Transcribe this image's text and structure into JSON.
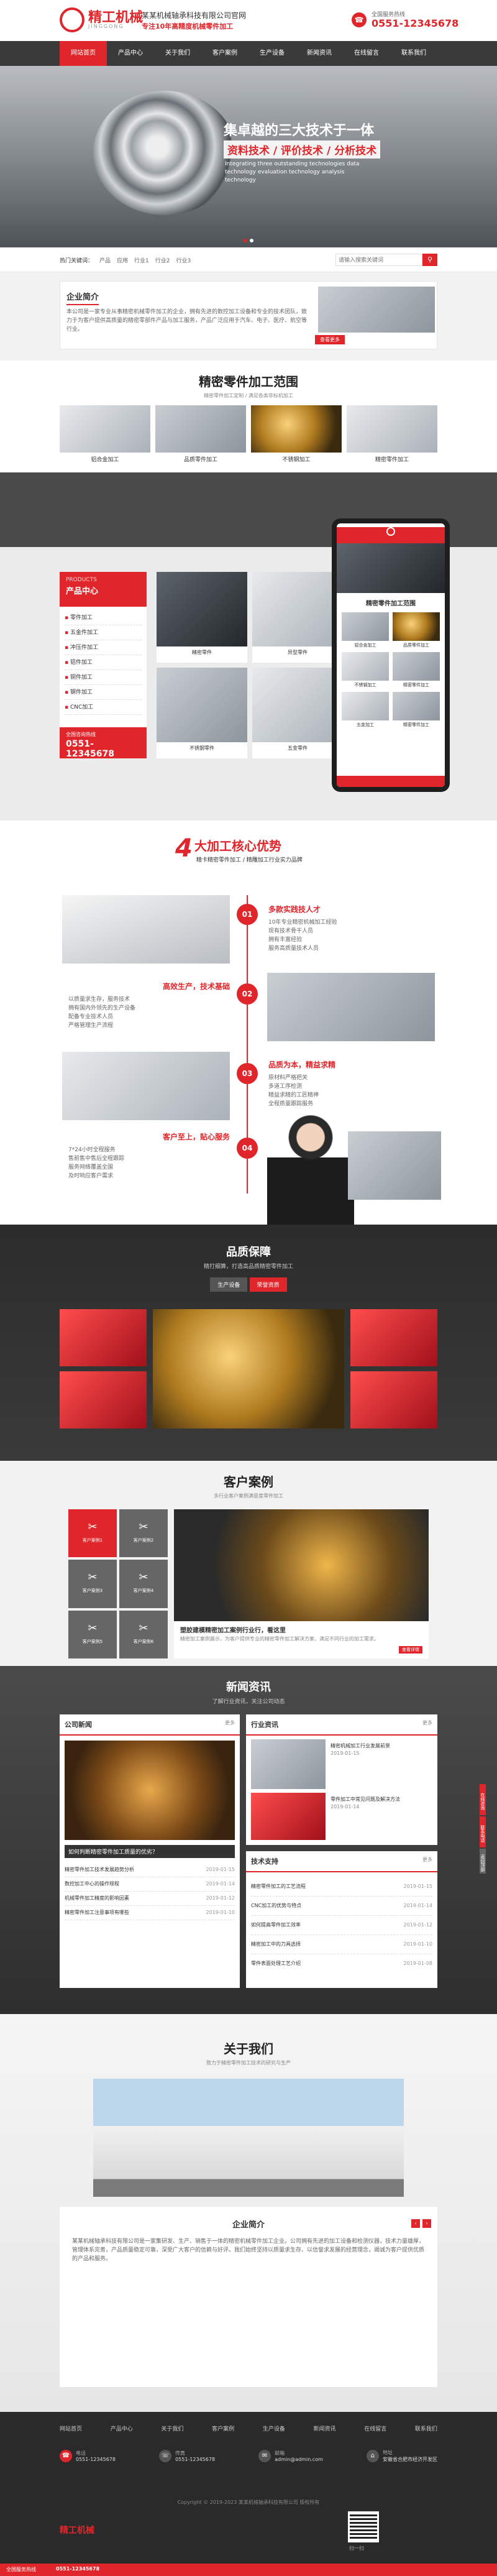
{
  "header": {
    "logo_text": "精工机械",
    "logo_sub": "JINGGONG",
    "company": "某某机械轴承科技有限公司官网",
    "slogan": "专注10年高精度机械零件加工",
    "hotline_label": "全国服务热线",
    "hotline": "0551-12345678"
  },
  "nav": {
    "items": [
      "网站首页",
      "产品中心",
      "关于我们",
      "客户案例",
      "生产设备",
      "新闻资讯",
      "在线留言",
      "联系我们"
    ]
  },
  "banner": {
    "title": "集卓越的三大技术于一体",
    "subtitle": "资料技术 / 评价技术 / 分析技术",
    "en": "Integrating three outstanding technologies data technology evaluation technology analysis technology"
  },
  "search": {
    "hot_label": "热门关键词：",
    "keywords": [
      "产品",
      "应用",
      "行业1",
      "行业2",
      "行业3"
    ],
    "placeholder": "请输入搜索关键词"
  },
  "intro": {
    "title": "企业简介",
    "text": "本公司是一家专业从事精密机械零件加工的企业，拥有先进的数控加工设备和专业的技术团队，致力于为客户提供高质量的精密零部件产品与加工服务，产品广泛应用于汽车、电子、医疗、航空等行业。",
    "more": "查看更多"
  },
  "range": {
    "title": "精密零件加工范围",
    "sub": "精密零件加工定制 / 满足各类非标机加工",
    "items": [
      "铝合金加工",
      "品质零件加工",
      "不锈钢加工",
      "精密零件加工"
    ]
  },
  "products": {
    "cat_en": "PRODUCTS",
    "cat_title": "产品中心",
    "cats": [
      "零件加工",
      "五金件加工",
      "冲压件加工",
      "铝件加工",
      "铜件加工",
      "钢件加工",
      "CNC加工"
    ],
    "hotline_label": "全国咨询热线",
    "hotline": "0551-12345678",
    "grid": [
      "精密零件",
      "异型零件",
      "不锈钢零件",
      "五金零件",
      "精密零件",
      "铝合金零件"
    ]
  },
  "phone": {
    "title": "精密零件加工范围",
    "items": [
      "铝合金加工",
      "品质零件加工",
      "不锈钢加工",
      "精密零件加工",
      "五金加工",
      "精密零件加工"
    ]
  },
  "advantage": {
    "num": "4",
    "title": "大加工核心优势",
    "sub": "精卡精密零件加工 / 精雕加工行业实力品牌",
    "items": [
      {
        "no": "01",
        "title": "多款实践技人才",
        "lines": [
          "10年专业精密机械加工经验",
          "现有技术骨干人员",
          "拥有丰富经验",
          "服务高质量技术人员"
        ]
      },
      {
        "no": "02",
        "title": "高效生产，技术基础",
        "lines": [
          "以质量求生存，服务技术",
          "拥有国内外领先的生产设备",
          "配备专业技术人员",
          "严格管理生产流程"
        ]
      },
      {
        "no": "03",
        "title": "品质为本，精益求精",
        "lines": [
          "原材料严格把关",
          "多道工序检测",
          "精益求精的工匠精神",
          "全程质量跟踪服务"
        ]
      },
      {
        "no": "04",
        "title": "客户至上，贴心服务",
        "lines": [
          "7*24小时全程服务",
          "售前售中售后全程跟踪",
          "服务网络覆盖全国",
          "及时响应客户需求"
        ]
      }
    ]
  },
  "quality": {
    "title": "品质保障",
    "sub": "精打细算，打造高品质精密零件加工",
    "tabs": [
      "生产设备",
      "荣誉资质"
    ]
  },
  "cases": {
    "title": "客户案例",
    "sub": "多行业客户案例满意度零件加工",
    "grid": [
      "客户案例1",
      "客户案例2",
      "客户案例3",
      "客户案例4",
      "客户案例5",
      "客户案例6"
    ],
    "feature_title": "塑胶建模精密加工案例行业行，看这里",
    "feature_text": "精密加工案例展示，为客户提供专业的精密零件加工解决方案，满足不同行业的加工需求。",
    "feature_more": "查看详情"
  },
  "news": {
    "title": "新闻资讯",
    "sub": "了解行业资讯，关注公司动态",
    "col1_title": "公司新闻",
    "col2_title": "行业资讯",
    "col3_title": "技术支持",
    "more": "更多",
    "feature": "如何判断精密零件加工质量的优劣？",
    "list1": [
      {
        "t": "精密零件加工技术发展趋势分析",
        "d": "2019-01-15"
      },
      {
        "t": "数控加工中心的操作规程",
        "d": "2019-01-14"
      },
      {
        "t": "机械零件加工精度的影响因素",
        "d": "2019-01-12"
      },
      {
        "t": "精密零件加工注意事项有哪些",
        "d": "2019-01-10"
      }
    ],
    "list2": [
      {
        "t": "精密机械加工行业发展前景",
        "d": "2019-01-15"
      },
      {
        "t": "零件加工中常见问题及解决方法",
        "d": "2019-01-14"
      }
    ],
    "list3": [
      {
        "t": "精密零件加工的工艺流程",
        "d": "2019-01-15"
      },
      {
        "t": "CNC加工的优势与特点",
        "d": "2019-01-14"
      },
      {
        "t": "如何提高零件加工效率",
        "d": "2019-01-12"
      },
      {
        "t": "精密加工中的刀具选择",
        "d": "2019-01-10"
      },
      {
        "t": "零件表面处理工艺介绍",
        "d": "2019-01-08"
      }
    ]
  },
  "about": {
    "title": "关于我们",
    "sub": "致力于精密零件加工技术的研究与生产",
    "card_title": "企业简介",
    "text": "某某机械轴承科技有限公司是一家集研发、生产、销售于一体的精密机械零件加工企业。公司拥有先进的加工设备和检测仪器，技术力量雄厚，管理体系完善，产品质量稳定可靠，深受广大客户的信赖与好评。我们始终坚持以质量求生存、以信誉求发展的经营理念，竭诚为客户提供优质的产品和服务。"
  },
  "footer": {
    "nav": [
      "网站首页",
      "产品中心",
      "关于我们",
      "客户案例",
      "生产设备",
      "新闻资讯",
      "在线留言",
      "联系我们"
    ],
    "contacts": [
      {
        "label": "电话",
        "v": "0551-12345678"
      },
      {
        "label": "传真",
        "v": "0551-12345678"
      },
      {
        "label": "邮箱",
        "v": "admin@admin.com"
      },
      {
        "label": "地址",
        "v": "安徽省合肥市经济开发区"
      }
    ],
    "copyright": "Copyright © 2019-2023 某某机械轴承科技有限公司 版权所有",
    "logo": "精工机械",
    "qr_label": "扫一扫"
  },
  "sidebar": {
    "items": [
      "在线咨询",
      "联系电话",
      "返回顶部"
    ]
  },
  "bottom_bar": {
    "label": "全国服务热线",
    "phone": "0551-12345678"
  }
}
